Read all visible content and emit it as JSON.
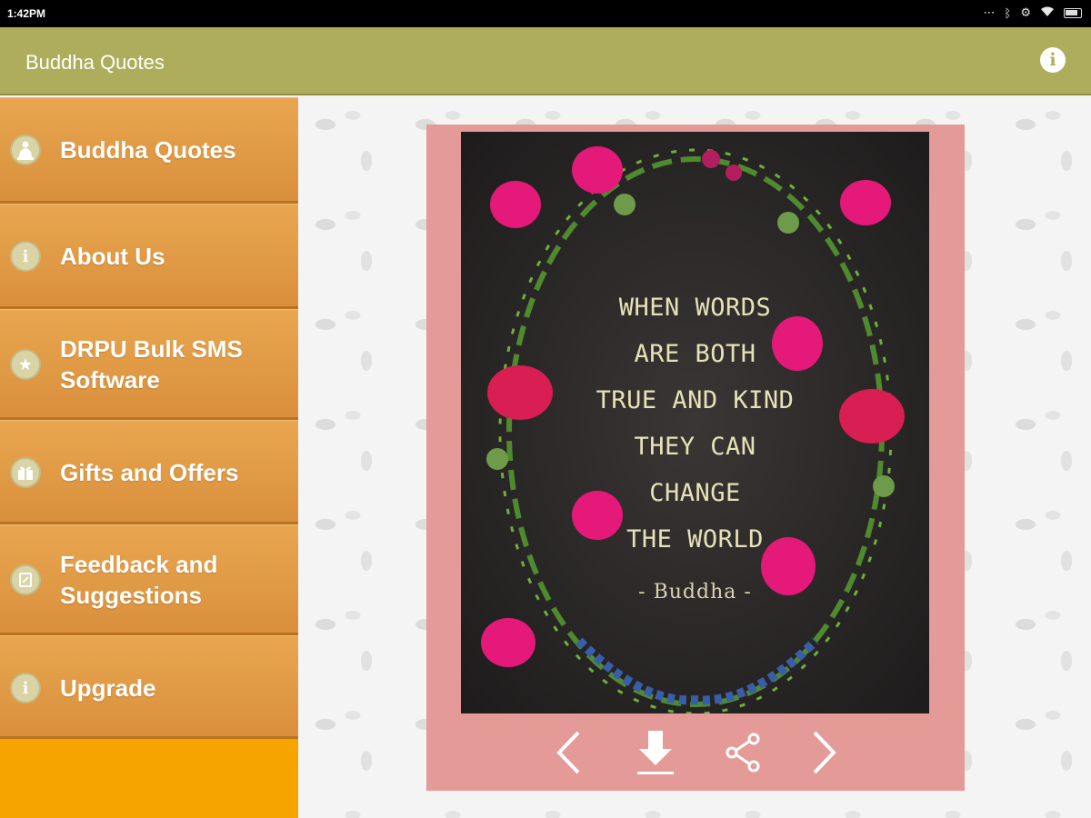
{
  "status_bar": {
    "time": "1:42PM"
  },
  "app_bar": {
    "title": "Buddha Quotes"
  },
  "sidebar": {
    "items": [
      {
        "label": "Buddha Quotes",
        "icon": "buddha-icon"
      },
      {
        "label": "About Us",
        "icon": "info-icon"
      },
      {
        "label": "DRPU Bulk SMS Software",
        "line1": "DRPU Bulk SMS",
        "line2": "Software",
        "icon": "star-icon"
      },
      {
        "label": "Gifts and Offers",
        "icon": "gift-icon"
      },
      {
        "label": "Feedback and Suggestions",
        "line1": "Feedback and",
        "line2": "Suggestions",
        "icon": "feedback-icon"
      },
      {
        "label": "Upgrade",
        "icon": "info-icon"
      }
    ]
  },
  "quote": {
    "lines": [
      "WHEN WORDS",
      "ARE BOTH",
      "TRUE AND KIND",
      "THEY CAN",
      "CHANGE",
      "THE WORLD"
    ],
    "author": "- Buddha -"
  },
  "toolbar": {
    "icons": [
      "chevron-left-icon",
      "download-icon",
      "share-icon",
      "chevron-right-icon"
    ]
  },
  "colors": {
    "app_bar": "#aead5c",
    "sidebar_item": "#e09a45",
    "sidebar_bg": "#f6a400",
    "card_frame": "#e49a97",
    "quote_text": "#e6e2b8"
  }
}
